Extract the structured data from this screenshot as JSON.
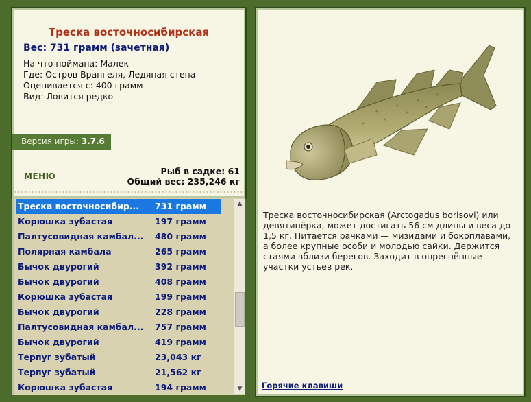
{
  "fish": {
    "title": "Треска восточносибирская",
    "weight": "Вес: 731 грамм (зачетная)",
    "caught_on": "На что поймана: Малек",
    "location": "Где: Остров Врангеля, Ледяная стена",
    "min_weight": "Оценивается с: 400 грамм",
    "kind": "Вид: Ловится редко"
  },
  "version": {
    "label": "Версия игры:",
    "value": "3.7.6"
  },
  "menu_label": "МЕНЮ",
  "stats": {
    "count": "Рыб в садке: 61",
    "total": "Общий вес: 235,246 кг"
  },
  "catch_list": [
    {
      "name": "Треска восточносибир...",
      "weight": "731 грамм"
    },
    {
      "name": "Корюшка зубастая",
      "weight": "197 грамм"
    },
    {
      "name": "Палтусовидная камбал...",
      "weight": "480 грамм"
    },
    {
      "name": "Полярная камбала",
      "weight": "265 грамм"
    },
    {
      "name": "Бычок двурогий",
      "weight": "392 грамм"
    },
    {
      "name": "Бычок двурогий",
      "weight": "408 грамм"
    },
    {
      "name": "Корюшка зубастая",
      "weight": "199 грамм"
    },
    {
      "name": "Бычок двурогий",
      "weight": "228 грамм"
    },
    {
      "name": "Палтусовидная камбал...",
      "weight": "757 грамм"
    },
    {
      "name": "Бычок двурогий",
      "weight": "419 грамм"
    },
    {
      "name": "Терпуг зубатый",
      "weight": "23,043 кг"
    },
    {
      "name": "Терпуг зубатый",
      "weight": "21,562 кг"
    },
    {
      "name": "Корюшка зубастая",
      "weight": "194 грамм"
    }
  ],
  "description": "Треска восточносибирская (Arctogadus borisovi) или девятипёрка, может достигать 56 см длины и веса до 1,5 кг. Питается рачками — мизидами и бокоплавами, а более крупные особи и молодью сайки. Держится стаями вблизи берегов. Заходит в опреснённые участки устьев рек.",
  "hotkeys_label": "Горячие клавиши",
  "colors": {
    "accent": "#1a78e0",
    "title": "#b03018",
    "frame": "#4c6c2c"
  }
}
